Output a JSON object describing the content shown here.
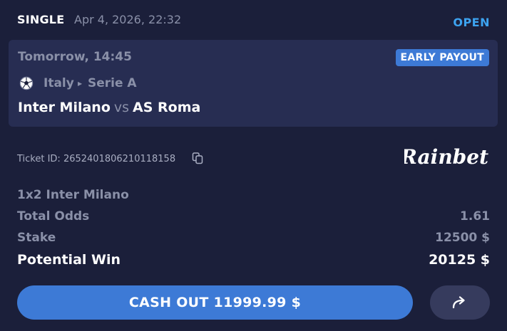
{
  "header": {
    "bet_type": "SINGLE",
    "date": "Apr 4, 2026, 22:32",
    "status": "OPEN"
  },
  "event": {
    "start_time": "Tomorrow, 14:45",
    "badge": "EARLY PAYOUT",
    "sport": "Italy",
    "league": "Serie A",
    "home_team": "Inter Milano",
    "vs": "vs",
    "away_team": "AS Roma",
    "sport_icon": "soccer-ball-icon"
  },
  "ticket": {
    "label": "Ticket ID: 2652401806210118158",
    "copy_icon": "copy-icon"
  },
  "brand": {
    "name": "Rainbet"
  },
  "details": {
    "selection": "1x2 Inter Milano",
    "total_odds_label": "Total Odds",
    "total_odds_value": "1.61",
    "stake_label": "Stake",
    "stake_value": "12500 $",
    "potential_win_label": "Potential Win",
    "potential_win_value": "20125 $"
  },
  "actions": {
    "cashout_label": "CASH OUT 11999.99 $",
    "share_icon": "share-arrow-icon"
  },
  "colors": {
    "background": "#1b1f3a",
    "card": "#272d52",
    "accent": "#3d7ad6",
    "status": "#3da3f0",
    "muted": "#8a90a8"
  }
}
